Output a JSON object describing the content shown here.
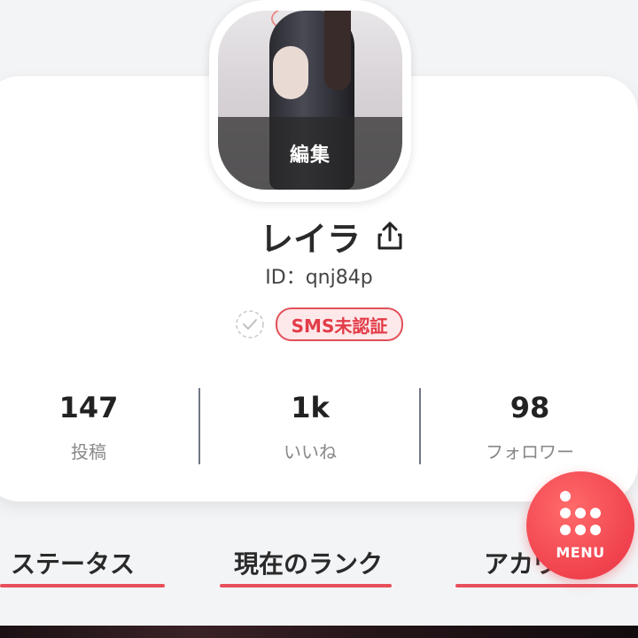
{
  "profile": {
    "avatar_edit_label": "編集",
    "display_name": "レイラ",
    "user_id": "ID：qnj84p",
    "sms_badge": "SMS未認証"
  },
  "stats": [
    {
      "value": "147",
      "label": "投稿"
    },
    {
      "value": "1k",
      "label": "いいね"
    },
    {
      "value": "98",
      "label": "フォロワー"
    }
  ],
  "tabs": [
    "ステータス",
    "現在のランク",
    "アカウ"
  ],
  "menu": {
    "label": "MENU"
  },
  "colors": {
    "accent": "#e84f5b",
    "badge_bg": "#fde8ea",
    "fab": "#f0424e"
  }
}
